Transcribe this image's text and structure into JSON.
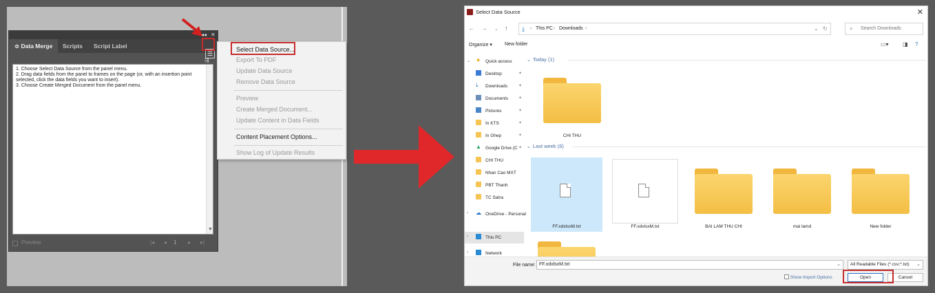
{
  "left": {
    "panel": {
      "tabs": [
        "Data Merge",
        "Scripts",
        "Script Label"
      ],
      "tab_prefix": "≎",
      "instructions": [
        "1. Choose Select Data Source from the panel menu.",
        "2. Drag data fields from the panel to frames on the page (or, with an insertion point selected, click the data fields you want to insert).",
        "3. Choose Create Merged Document from the panel menu."
      ],
      "preview_label": "Preview",
      "page_number": "1"
    },
    "menu": {
      "items": [
        {
          "label": "Select Data Source...",
          "enabled": true
        },
        {
          "label": "Export To PDF",
          "enabled": false
        },
        {
          "label": "Update Data Source",
          "enabled": false
        },
        {
          "label": "Remove Data Source",
          "enabled": false
        },
        {
          "label": "Preview",
          "enabled": false
        },
        {
          "label": "Create Merged Document...",
          "enabled": false
        },
        {
          "label": "Update Content in Data Fields",
          "enabled": false
        },
        {
          "label": "Content Placement Options...",
          "enabled": true
        },
        {
          "label": "Show Log of Update Results",
          "enabled": false
        }
      ]
    }
  },
  "dialog": {
    "title": "Select Data Source",
    "breadcrumb": [
      "This PC",
      "Downloads"
    ],
    "search_placeholder": "Search Downloads",
    "toolbar": {
      "organize": "Organize ▾",
      "new_folder": "New folder"
    },
    "nav": [
      {
        "label": "Quick access",
        "icon": "star-icon",
        "expander": true
      },
      {
        "label": "Desktop",
        "icon": "desktop-icon",
        "pin": true
      },
      {
        "label": "Downloads",
        "icon": "download-icon",
        "pin": true
      },
      {
        "label": "Documents",
        "icon": "documents-icon",
        "pin": true
      },
      {
        "label": "Pictures",
        "icon": "pictures-icon",
        "pin": true
      },
      {
        "label": "In KTS",
        "icon": "folder-icon",
        "pin": true
      },
      {
        "label": "In Ghep",
        "icon": "folder-icon",
        "pin": true
      },
      {
        "label": "Google Drive (C",
        "icon": "google-drive-icon",
        "pin": true
      },
      {
        "label": "CHI THU",
        "icon": "folder-icon"
      },
      {
        "label": "Nhan Cao MXT",
        "icon": "folder-icon"
      },
      {
        "label": "PBT Thanh",
        "icon": "folder-icon"
      },
      {
        "label": "TC Satra",
        "icon": "folder-icon"
      },
      {
        "label": "OneDrive - Personal",
        "icon": "onedrive-icon",
        "expander": true
      },
      {
        "label": "This PC",
        "icon": "this-pc-icon",
        "expander": true,
        "selected": true
      },
      {
        "label": "Network",
        "icon": "network-icon",
        "expander": true
      }
    ],
    "groups": [
      {
        "title": "Today (1)",
        "items": [
          {
            "name": "CHI THU",
            "type": "folder"
          }
        ]
      },
      {
        "title": "Last week (6)",
        "items": [
          {
            "name": "FF.xdxlsxM.txt",
            "type": "file",
            "selected": true
          },
          {
            "name": "FF.xdxlsxM.txt",
            "type": "file"
          },
          {
            "name": "BAI LAM THU CHI",
            "type": "folder"
          },
          {
            "name": "mai lamd",
            "type": "folder"
          },
          {
            "name": "New folder",
            "type": "folder"
          },
          {
            "name": "",
            "type": "folder"
          }
        ]
      }
    ],
    "file_name_label": "File name:",
    "file_name_value": "FF.xdxlsxM.txt",
    "filter": "All Readable Files (*.csv;*.txt)",
    "show_import": "Show Import Options",
    "open": "Open",
    "cancel": "Cancel"
  },
  "colors": {
    "highlight_red": "#c62a2a",
    "selection_blue": "#cde8fb",
    "folder_yellow": "#f5c453"
  }
}
